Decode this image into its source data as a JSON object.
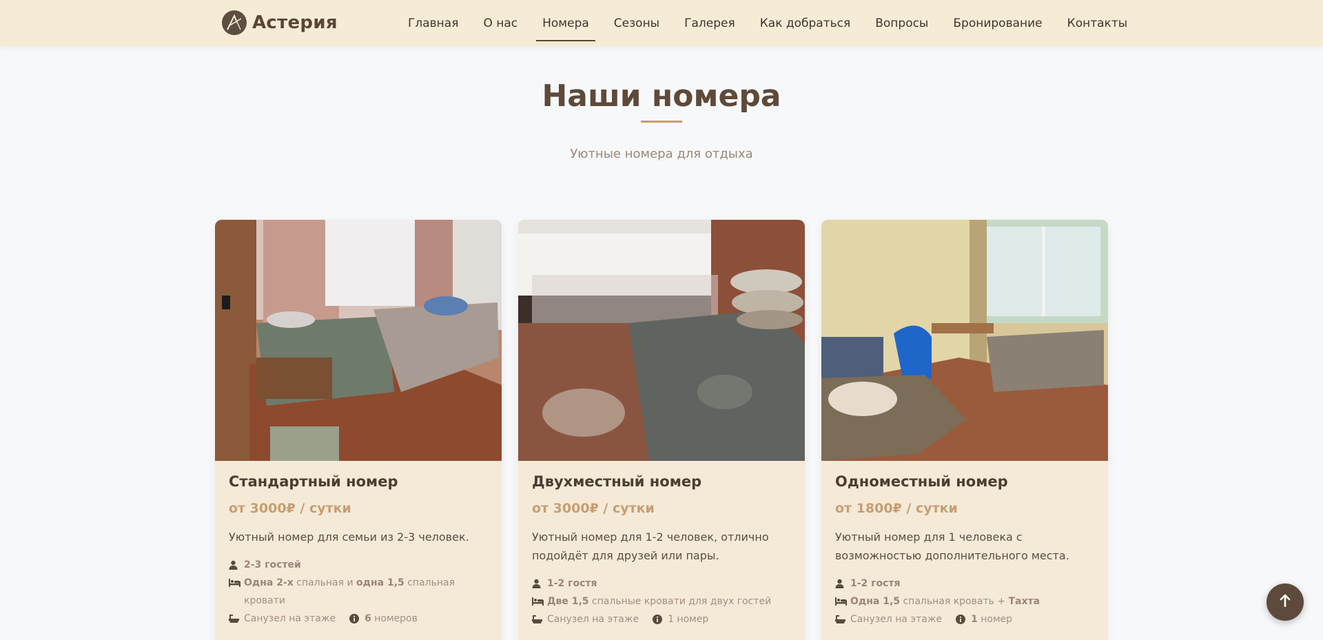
{
  "brand": {
    "name": "Астерия"
  },
  "nav": [
    {
      "label": "Главная"
    },
    {
      "label": "О нас"
    },
    {
      "label": "Номера",
      "active": true
    },
    {
      "label": "Сезоны"
    },
    {
      "label": "Галерея"
    },
    {
      "label": "Как добраться"
    },
    {
      "label": "Вопросы"
    },
    {
      "label": "Бронирование"
    },
    {
      "label": "Контакты"
    }
  ],
  "section": {
    "title": "Наши номера",
    "subtitle": "Уютные номера для отдыха"
  },
  "rooms": [
    {
      "title": "Стандартный номер",
      "price": "от 3000₽ / сутки",
      "description": "Уютный номер для семьи из 2-3 человек.",
      "guests": "2-3 гостей",
      "beds": {
        "b1": "Одна 2-х",
        "t1": " спальная и ",
        "b2": "одна 1,5",
        "t2": " спальная кровати"
      },
      "bathroom": "Санузел на этаже",
      "count_bold": "6",
      "count_text": " номеров"
    },
    {
      "title": "Двухместный номер",
      "price": "от 3000₽ / сутки",
      "description": "Уютный номер для 1-2 человек, отлично подойдёт для друзей или пары.",
      "guests": "1-2 гостя",
      "beds": {
        "b1": "Две 1,5",
        "t1": " спальные кровати для двух гостей",
        "b2": "",
        "t2": ""
      },
      "bathroom": "Санузел на этаже",
      "count_bold": "",
      "count_text": "1 номер"
    },
    {
      "title": "Одноместный номер",
      "price": "от 1800₽ / сутки",
      "description": "Уютный номер для 1 человека с возможностью дополнительного места.",
      "guests": "1-2 гостя",
      "beds": {
        "b1": "Одна 1,5",
        "t1": " спальная кровать + ",
        "b2": "Тахта",
        "t2": ""
      },
      "bathroom": "Санузел на этаже",
      "count_bold": "1",
      "count_text": " номер"
    }
  ],
  "icons": {
    "logo": "asteria-logo-icon",
    "guests": "user-icon",
    "beds": "bed-icon",
    "bathroom": "bath-icon",
    "count": "info-icon",
    "to_top": "arrow-up-icon"
  },
  "colors": {
    "header_bg": "#f6ebd5",
    "card_bg": "#f5ead8",
    "accent": "#c79e72",
    "brand_dark": "#5e4a3c"
  }
}
